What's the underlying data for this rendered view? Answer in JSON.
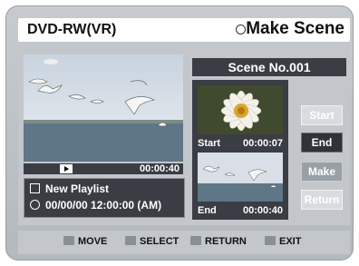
{
  "header": {
    "device": "DVD-RW(VR)",
    "title": "Make Scene"
  },
  "player": {
    "time": "00:00:40",
    "play_icon": "play-icon"
  },
  "playlist": {
    "name": "New Playlist",
    "datetime": "00/00/00 12:00:00 (AM)"
  },
  "scene": {
    "title": "Scene No.001"
  },
  "thumbs": {
    "start": {
      "label": "Start",
      "time": "00:00:07"
    },
    "end": {
      "label": "End",
      "time": "00:00:40"
    }
  },
  "buttons": {
    "start": "Start",
    "end": "End",
    "make": "Make",
    "return": "Return"
  },
  "footer": {
    "move": "MOVE",
    "select": "SELECT",
    "return": "RETURN",
    "exit": "EXIT"
  },
  "colors": {
    "panel": "#3a3d44",
    "frame": "#c3c6ca"
  }
}
